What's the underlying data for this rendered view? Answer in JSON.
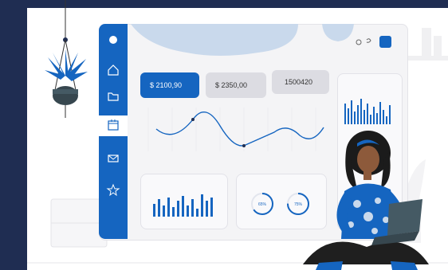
{
  "cards": [
    {
      "label": "$ 2100,90",
      "active": true
    },
    {
      "label": "$ 2350,00",
      "active": false
    },
    {
      "label": "1500420",
      "active": false
    }
  ],
  "donuts": [
    {
      "label": "65%",
      "percent": 65
    },
    {
      "label": "75%",
      "percent": 75
    }
  ],
  "sidebar_icons": [
    "home-icon",
    "folder-icon",
    "calendar-icon",
    "mail-icon",
    "star-icon"
  ],
  "colors": {
    "accent": "#1565c0",
    "background": "#1f2d52",
    "blob": "#c9d9ec"
  }
}
